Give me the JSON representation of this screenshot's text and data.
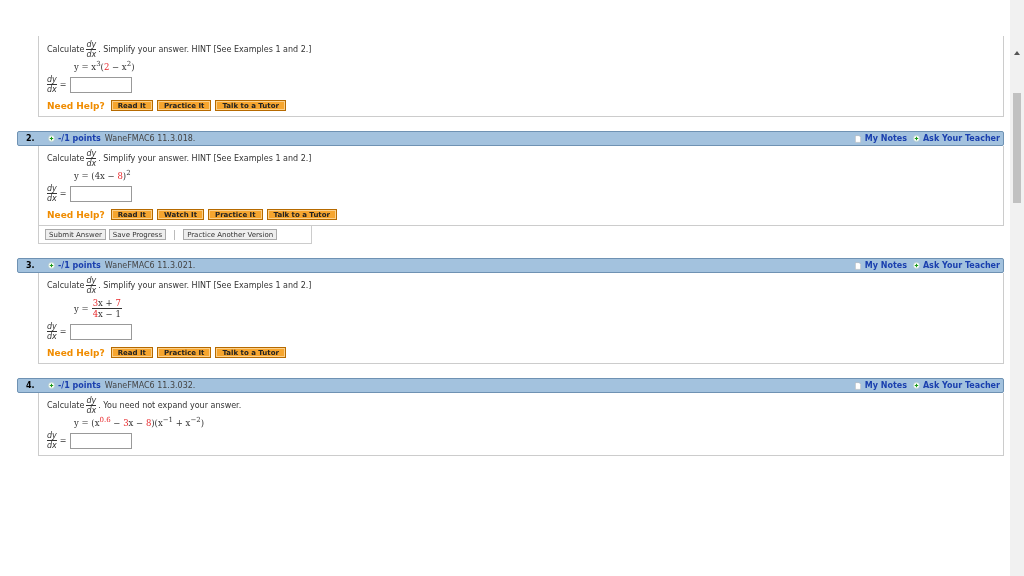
{
  "questions": [
    {
      "prompt_before": "Calculate",
      "derivative": {
        "num": "dy",
        "den": "dx"
      },
      "prompt_after": ". Simplify your answer. HINT [See Examples 1 and 2.]",
      "equation": {
        "kind": "inline",
        "parts": [
          {
            "t": "y = x",
            "kind": "text",
            "red": false
          },
          {
            "t": "3",
            "kind": "sup",
            "red": false
          },
          {
            "t": "(",
            "kind": "text",
            "red": false
          },
          {
            "t": "2",
            "kind": "text",
            "red": true
          },
          {
            "t": " − x",
            "kind": "text",
            "red": false
          },
          {
            "t": "2",
            "kind": "sup",
            "red": false
          },
          {
            "t": ")",
            "kind": "text",
            "red": false
          }
        ]
      },
      "answer": {
        "num": "dy",
        "den": "dx",
        "equals": "="
      },
      "help": {
        "label": "Need Help?",
        "buttons": [
          "Read It",
          "Practice It",
          "Talk to a Tutor"
        ]
      }
    },
    {
      "header": {
        "number": "2.",
        "points": "-/1 points",
        "source": "WaneFMAC6 11.3.018.",
        "notes": "My Notes",
        "ask": "Ask Your Teacher"
      },
      "prompt_before": "Calculate",
      "derivative": {
        "num": "dy",
        "den": "dx"
      },
      "prompt_after": ". Simplify your answer. HINT [See Examples 1 and 2.]",
      "equation": {
        "kind": "inline",
        "parts": [
          {
            "t": "y = (4x − ",
            "kind": "text",
            "red": false
          },
          {
            "t": "8",
            "kind": "text",
            "red": true
          },
          {
            "t": ")",
            "kind": "text",
            "red": false
          },
          {
            "t": "2",
            "kind": "sup",
            "red": false
          }
        ]
      },
      "answer": {
        "num": "dy",
        "den": "dx",
        "equals": "="
      },
      "help": {
        "label": "Need Help?",
        "buttons": [
          "Read It",
          "Watch It",
          "Practice It",
          "Talk to a Tutor"
        ]
      },
      "actions": [
        "Submit Answer",
        "Save Progress",
        "Practice Another Version"
      ]
    },
    {
      "header": {
        "number": "3.",
        "points": "-/1 points",
        "source": "WaneFMAC6 11.3.021.",
        "notes": "My Notes",
        "ask": "Ask Your Teacher"
      },
      "prompt_before": "Calculate",
      "derivative": {
        "num": "dy",
        "den": "dx"
      },
      "prompt_after": ". Simplify your answer. HINT [See Examples 1 and 2.]",
      "equation": {
        "kind": "fraction",
        "lhs": "y =",
        "num": [
          {
            "t": "3",
            "kind": "text",
            "red": true
          },
          {
            "t": "x + ",
            "kind": "text",
            "red": false
          },
          {
            "t": "7",
            "kind": "text",
            "red": true
          }
        ],
        "den": [
          {
            "t": "4",
            "kind": "text",
            "red": true
          },
          {
            "t": "x − 1",
            "kind": "text",
            "red": false
          }
        ]
      },
      "answer": {
        "num": "dy",
        "den": "dx",
        "equals": "="
      },
      "help": {
        "label": "Need Help?",
        "buttons": [
          "Read It",
          "Practice It",
          "Talk to a Tutor"
        ]
      }
    },
    {
      "header": {
        "number": "4.",
        "points": "-/1 points",
        "source": "WaneFMAC6 11.3.032.",
        "notes": "My Notes",
        "ask": "Ask Your Teacher"
      },
      "prompt_before": "Calculate",
      "derivative": {
        "num": "dy",
        "den": "dx"
      },
      "prompt_after": ". You need not expand your answer.",
      "equation": {
        "kind": "inline",
        "parts": [
          {
            "t": "y = (x",
            "kind": "text",
            "red": false
          },
          {
            "t": "0.6",
            "kind": "sup",
            "red": true
          },
          {
            "t": " − ",
            "kind": "text",
            "red": false
          },
          {
            "t": "3",
            "kind": "text",
            "red": true
          },
          {
            "t": "x − ",
            "kind": "text",
            "red": false
          },
          {
            "t": "8",
            "kind": "text",
            "red": true
          },
          {
            "t": ")(x",
            "kind": "text",
            "red": false
          },
          {
            "t": "−1",
            "kind": "sup",
            "red": false
          },
          {
            "t": " + x",
            "kind": "text",
            "red": false
          },
          {
            "t": "−2",
            "kind": "sup",
            "red": false
          },
          {
            "t": ")",
            "kind": "text",
            "red": false
          }
        ]
      },
      "answer": {
        "num": "dy",
        "den": "dx",
        "equals": "="
      }
    }
  ]
}
